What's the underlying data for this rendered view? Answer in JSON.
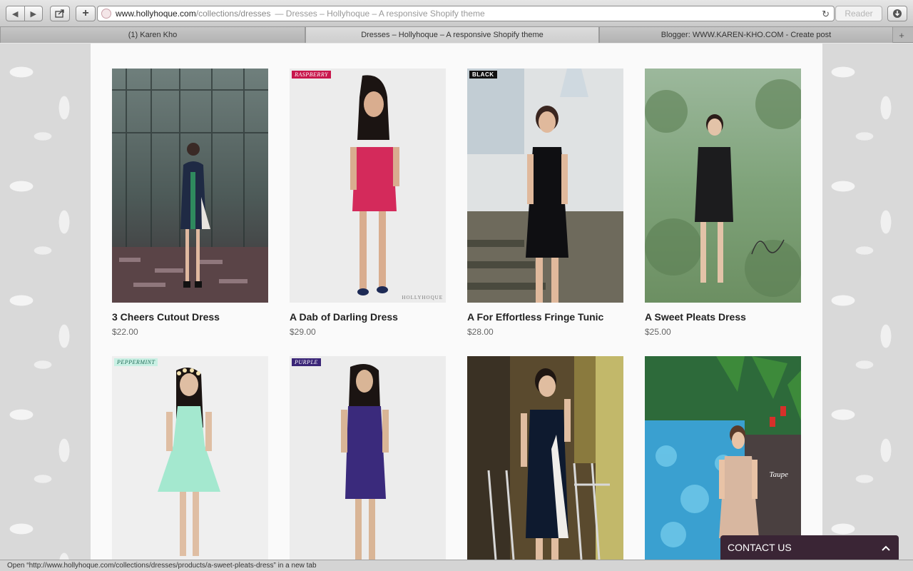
{
  "browser": {
    "address": {
      "host": "www.hollyhoque.com",
      "path": "/collections/dresses",
      "title_suffix": "— Dresses – Hollyhoque – A responsive Shopify theme"
    },
    "reader_label": "Reader",
    "tabs": [
      {
        "label": "(1) Karen Kho"
      },
      {
        "label": "Dresses – Hollyhoque – A responsive Shopify theme"
      },
      {
        "label": "Blogger: WWW.KAREN-KHO.COM - Create post"
      }
    ],
    "status": "Open “http://www.hollyhoque.com/collections/dresses/products/a-sweet-pleats-dress” in a new tab"
  },
  "products": [
    {
      "title": "3 Cheers Cutout Dress",
      "price": "$22.00"
    },
    {
      "title": "A Dab of Darling Dress",
      "price": "$29.00",
      "badge": "RASPBERRY",
      "watermark": "HOLLYHOQUE"
    },
    {
      "title": "A For Effortless Fringe Tunic",
      "price": "$28.00",
      "badge": "BLACK"
    },
    {
      "title": "A Sweet Pleats Dress",
      "price": "$25.00"
    },
    {
      "badge": "PEPPERMINT"
    },
    {
      "badge": "PURPLE"
    },
    {},
    {
      "watermark": "Taupe"
    }
  ],
  "contact": {
    "label": "CONTACT US"
  },
  "colors": {
    "accent": "#3a2535",
    "raspberry_badge": "#c8174c",
    "peppermint_badge": "#c9f0e4",
    "purple_badge": "#3a2577"
  }
}
